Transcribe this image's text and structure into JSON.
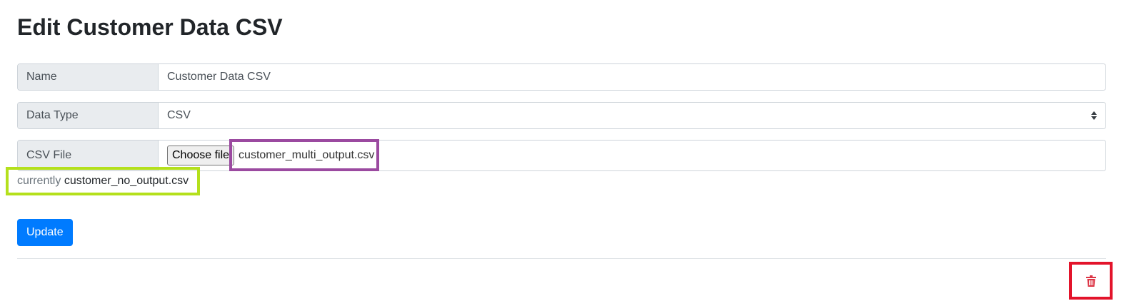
{
  "page": {
    "title": "Edit Customer Data CSV"
  },
  "form": {
    "name_label": "Name",
    "name_value": "Customer Data CSV",
    "type_label": "Data Type",
    "type_value": "CSV",
    "file_label": "CSV File",
    "choose_file_label": "Choose file",
    "chosen_file": "customer_multi_output.csv",
    "current_prefix": "currently",
    "current_file": "customer_no_output.csv",
    "update_label": "Update"
  },
  "icons": {
    "delete": "trash-icon",
    "select_arrows": "sort-arrows-icon"
  },
  "colors": {
    "primary": "#007bff",
    "danger": "#dc3545",
    "highlight_purple": "#9b4aa0",
    "highlight_green": "#b4e01c",
    "highlight_red": "#e3142b"
  }
}
